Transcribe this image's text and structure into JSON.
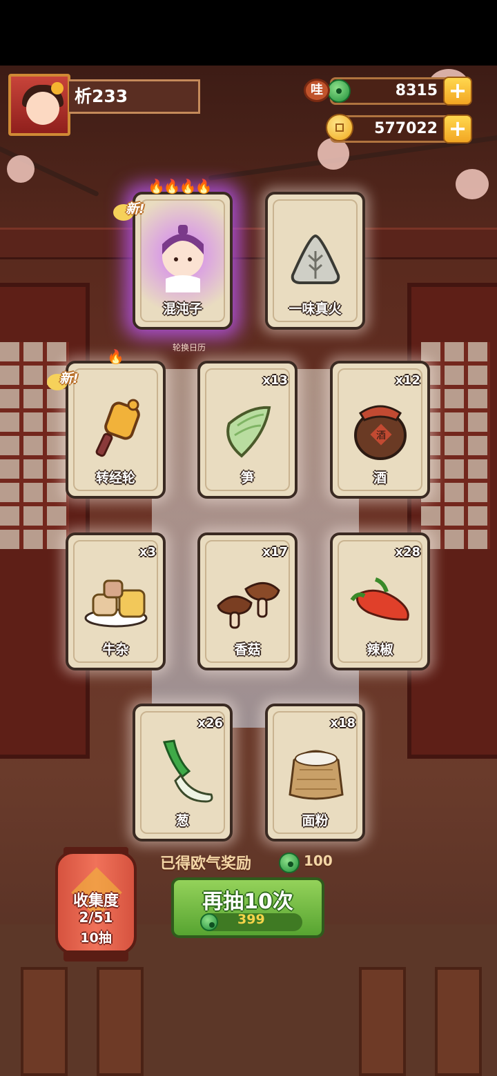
{
  "player": {
    "name": "析233"
  },
  "currencies": {
    "jade": {
      "badge": "哇",
      "value": "8315",
      "icon": "jade-coin-icon"
    },
    "gold": {
      "value": "577022",
      "icon": "gold-coin-icon"
    }
  },
  "new_label": "新!",
  "hero_caption": "轮换日历",
  "cards": [
    {
      "label": "混沌子",
      "qty": "",
      "rarity": "purple",
      "is_new": true,
      "flames": 4,
      "icon": "hundunzi-character-icon"
    },
    {
      "label": "一味真火",
      "qty": "",
      "rarity": "normal",
      "is_new": false,
      "flames": 0,
      "icon": "rice-dumpling-icon"
    },
    {
      "label": "转经轮",
      "qty": "",
      "rarity": "normal",
      "is_new": true,
      "flames": 1,
      "icon": "prayer-wheel-icon"
    },
    {
      "label": "笋",
      "qty": "x13",
      "rarity": "normal",
      "is_new": false,
      "flames": 0,
      "icon": "bamboo-shoot-icon"
    },
    {
      "label": "酒",
      "qty": "x12",
      "rarity": "normal",
      "is_new": false,
      "flames": 0,
      "icon": "wine-jar-icon",
      "jar_text": "酒"
    },
    {
      "label": "牛杂",
      "qty": "x3",
      "rarity": "normal",
      "is_new": false,
      "flames": 0,
      "icon": "beef-offal-icon"
    },
    {
      "label": "香菇",
      "qty": "x17",
      "rarity": "normal",
      "is_new": false,
      "flames": 0,
      "icon": "mushroom-icon"
    },
    {
      "label": "辣椒",
      "qty": "x28",
      "rarity": "normal",
      "is_new": false,
      "flames": 0,
      "icon": "chili-pepper-icon"
    },
    {
      "label": "葱",
      "qty": "x26",
      "rarity": "normal",
      "is_new": false,
      "flames": 0,
      "icon": "scallion-icon"
    },
    {
      "label": "面粉",
      "qty": "x18",
      "rarity": "normal",
      "is_new": false,
      "flames": 0,
      "icon": "flour-sack-icon"
    }
  ],
  "reward": {
    "text": "已得欧气奖励",
    "value": "100",
    "icon": "jade-coin-icon"
  },
  "draw_button": {
    "label": "再抽10次",
    "cost": "399",
    "icon": "jade-coin-icon"
  },
  "collection": {
    "title": "收集度",
    "progress": "2/51",
    "draws": "10抽"
  },
  "colors": {
    "purple_glow": "#be5aff",
    "button_green": "#6fb83d",
    "card_bg": "#e9dcc0"
  }
}
